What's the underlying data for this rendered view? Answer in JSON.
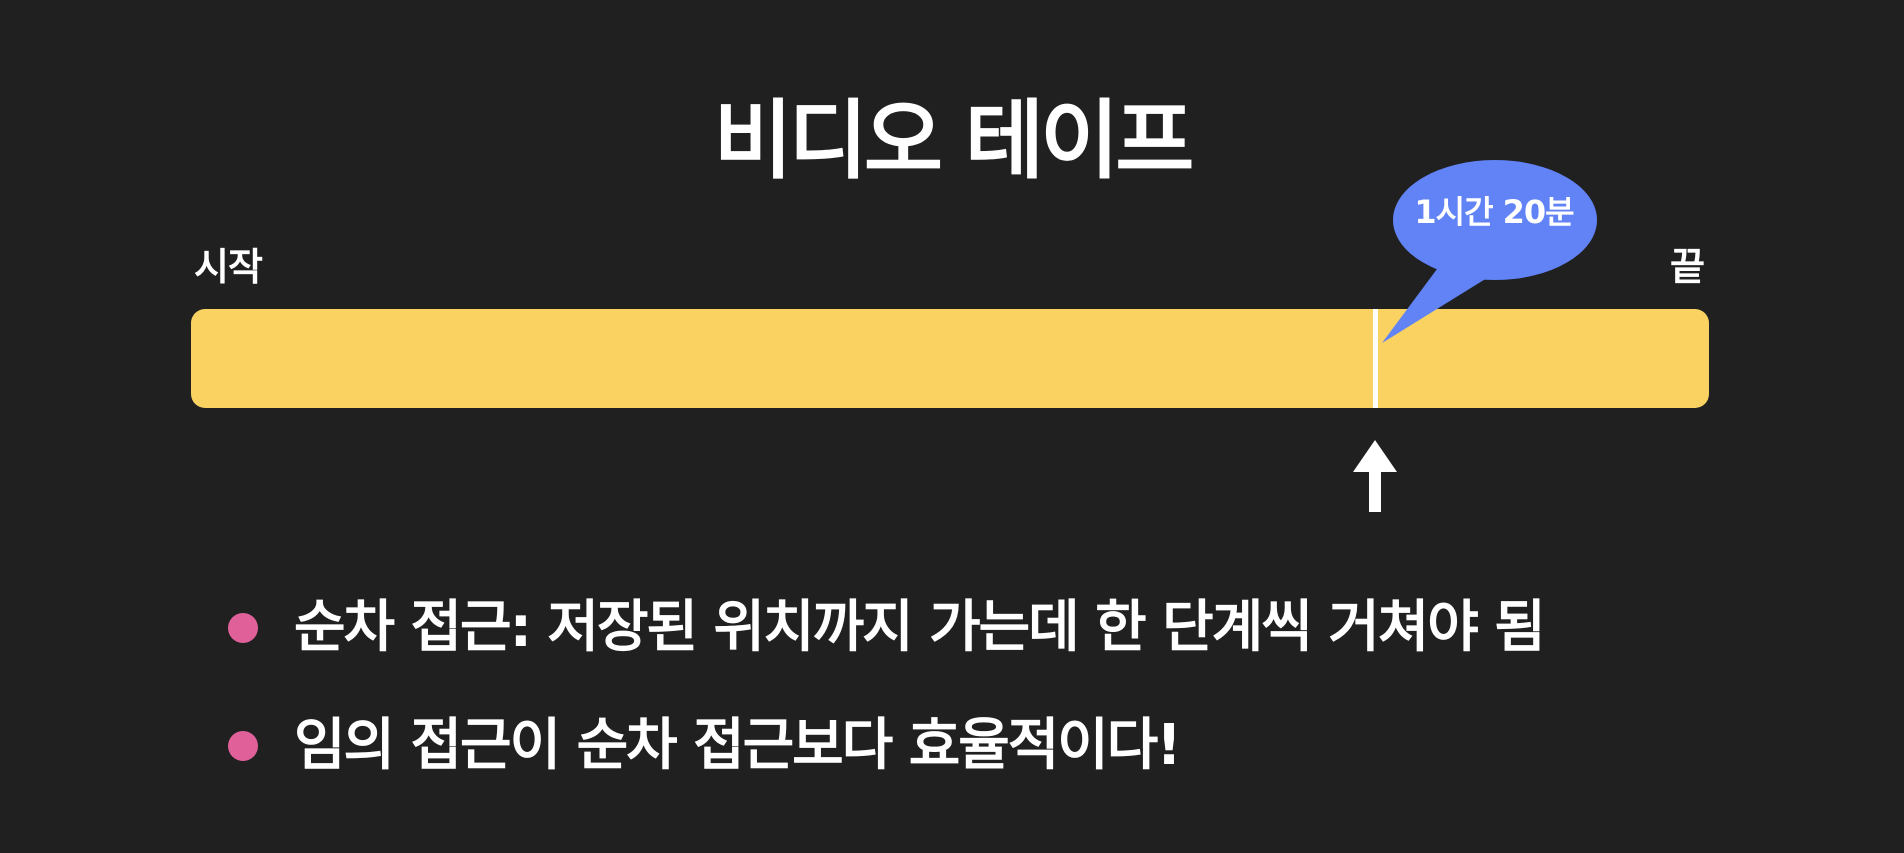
{
  "title": "비디오 테이프",
  "tape": {
    "start_label": "시작",
    "end_label": "끝",
    "marker_label": "1시간 20분",
    "marker_position_fraction": 0.66
  },
  "bullets": [
    "순차 접근: 저장된 위치까지 가는데 한 단계씩 거쳐야 됨",
    "임의 접근이 순차 접근보다 효율적이다!"
  ],
  "colors": {
    "background": "#202020",
    "tape": "#f9d262",
    "bubble": "#6183f6",
    "bullet_dot": "#e0609a",
    "text": "#ffffff"
  }
}
